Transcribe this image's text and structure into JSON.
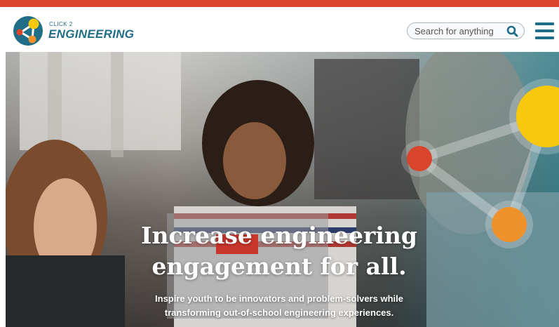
{
  "brand": {
    "small_text": "CLICK 2",
    "name": "ENGINEERING"
  },
  "search": {
    "placeholder": "Search for anything"
  },
  "colors": {
    "top_bar": "#d9452b",
    "brand_teal": "#1f6d86",
    "circle_yellow": "#f7c80b",
    "circle_red": "#d9452b",
    "circle_orange": "#f0922b"
  },
  "icons": {
    "search": "search-icon",
    "menu": "hamburger-menu-icon"
  },
  "hero": {
    "title_line1": "Increase engineering",
    "title_line2": "engagement for all.",
    "subtitle_line1": "Inspire youth to be innovators and problem-solvers while",
    "subtitle_line2": "transforming out-of-school engineering experiences."
  }
}
